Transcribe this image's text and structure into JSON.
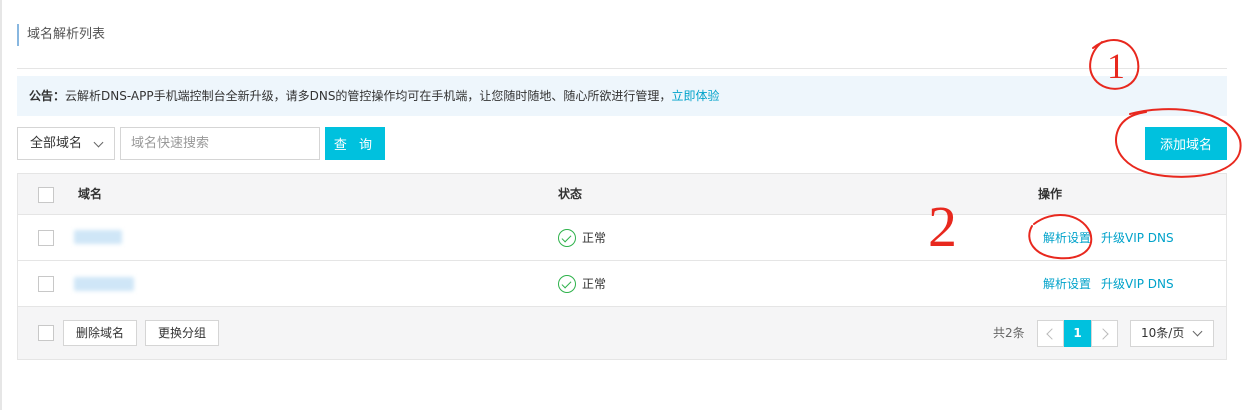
{
  "page": {
    "title": "域名解析列表"
  },
  "notice": {
    "label": "公告：",
    "text": "云解析DNS-APP手机端控制台全新升级，请多DNS的管控操作均可在手机端，让您随时随地、随心所欲进行管理，",
    "link": "立即体验"
  },
  "toolbar": {
    "filter_selected": "全部域名",
    "search_placeholder": "域名快速搜索",
    "query_label": "查 询",
    "add_label": "添加域名"
  },
  "table": {
    "columns": {
      "domain": "域名",
      "status": "状态",
      "ops": "操作"
    },
    "rows": [
      {
        "status": "正常",
        "op_settings": "解析设置",
        "op_upgrade": "升级VIP DNS"
      },
      {
        "status": "正常",
        "op_settings": "解析设置",
        "op_upgrade": "升级VIP DNS"
      }
    ]
  },
  "footer": {
    "delete_label": "删除域名",
    "regroup_label": "更换分组",
    "total": "共2条",
    "current_page": "1",
    "page_size": "10条/页"
  },
  "annotations": {
    "mark_1": "1",
    "mark_2": "2",
    "ink_color": "#e8281e"
  },
  "colors": {
    "accent": "#00c1de",
    "link": "#00a2ca",
    "success": "#2eb24b"
  }
}
